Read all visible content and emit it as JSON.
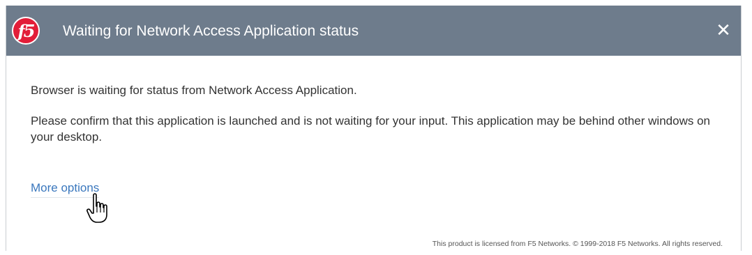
{
  "dialog": {
    "title": "Waiting for Network Access Application status",
    "logo_text": "f5",
    "close_symbol": "✕",
    "paragraph_1": "Browser is waiting for status from Network Access Application.",
    "paragraph_2": "Please confirm that this application is launched and is not waiting for your input. This application may be behind other windows on your desktop.",
    "more_options_label": "More options",
    "footer": "This product is licensed from F5 Networks. © 1999-2018 F5 Networks. All rights reserved."
  },
  "icons": {
    "logo": "f5-logo-icon",
    "close": "close-icon",
    "cursor": "hand-pointer-cursor-icon"
  },
  "colors": {
    "titlebar": "#6e7c8c",
    "logo_red": "#e21d38",
    "link": "#3a77bd",
    "text": "#333333"
  }
}
